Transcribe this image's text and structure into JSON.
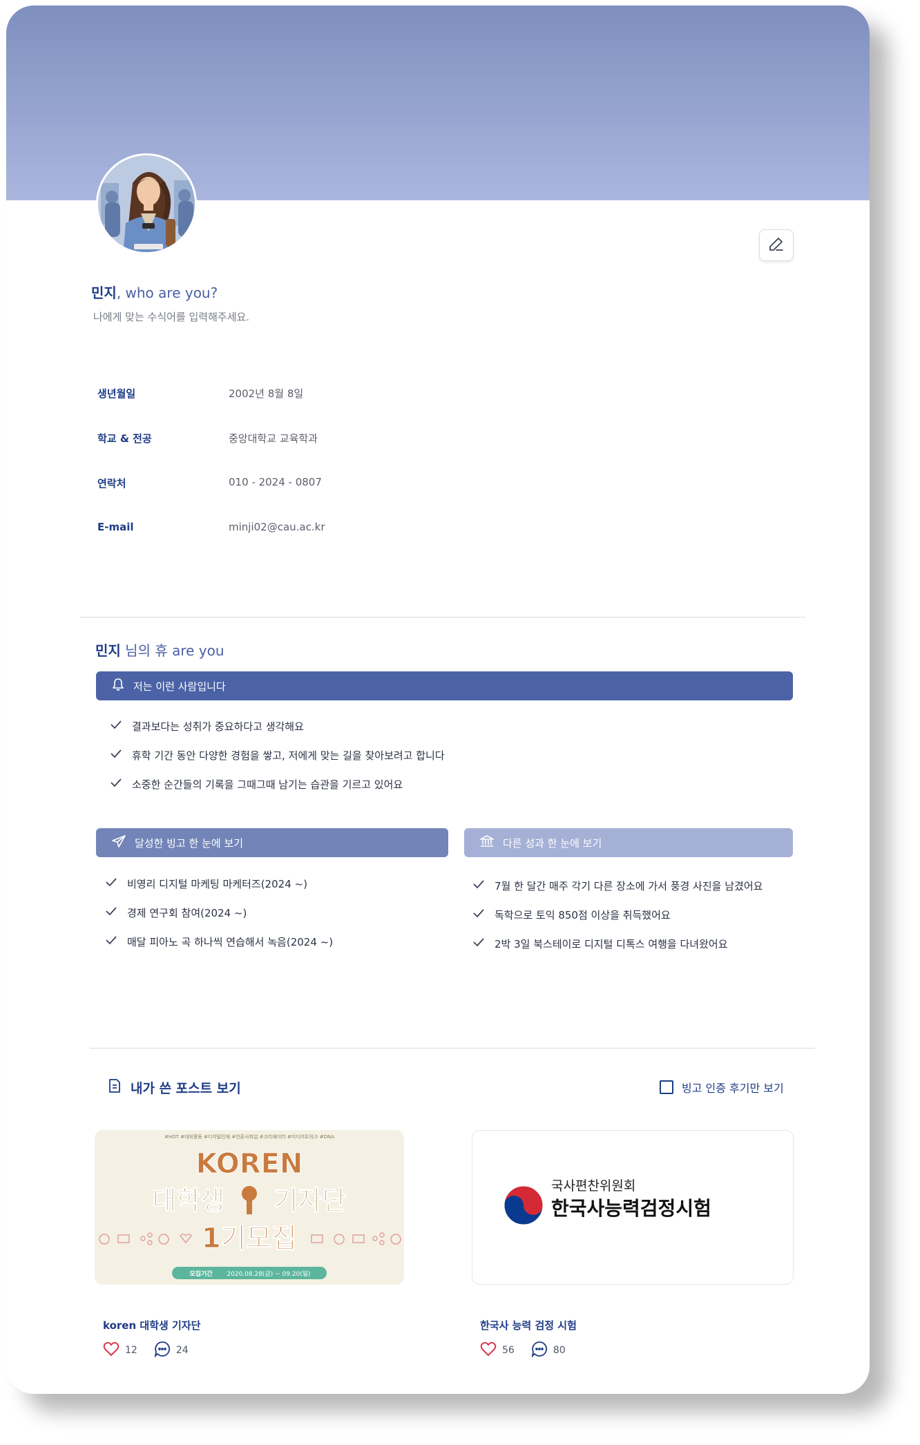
{
  "profile": {
    "name": "민지",
    "greeting_suffix": ", who are you?",
    "subtitle": "나에게 맞는 수식어를 입력해주세요."
  },
  "info": [
    {
      "label": "생년월일",
      "value": "2002년 8월 8일"
    },
    {
      "label": "학교 & 전공",
      "value": "중앙대학교 교육학과"
    },
    {
      "label": "연락처",
      "value": "010 - 2024 - 0807"
    },
    {
      "label": "E-mail",
      "value": "minji02@cau.ac.kr"
    }
  ],
  "who": {
    "name": "민지",
    "suffix": " 님의 휴 are you",
    "intro_bar": "저는 이런 사람입니다",
    "intro_items": [
      "결과보다는 성취가 중요하다고 생각해요",
      "휴학 기간 동안 다양한 경험을 쌓고, 저에게 맞는 길을 찾아보려고 합니다",
      "소중한 순간들의 기록을 그때그때 남기는 습관을 기르고 있어요"
    ],
    "bingo_bar": "달성한 빙고 한 눈에 보기",
    "bingo_items": [
      "비영리 디지털 마케팅 마케터즈(2024 ~)",
      "경제 연구회 참여(2024 ~)",
      "매달 피아노 곡 하나씩 연습해서 녹음(2024 ~)"
    ],
    "other_bar": "다른 성과 한 눈에 보기",
    "other_items": [
      "7월 한 달간 매주 각기 다른 장소에 가서 풍경 사진을 남겼어요",
      "독학으로 토익 850점 이상을 취득했어요",
      "2박 3일 북스테이로 디지털 디톡스 여행을 다녀왔어요"
    ]
  },
  "posts": {
    "heading": "내가 쓴 포스트 보기",
    "filter_label": "빙고 인증 후기만 보기",
    "items": [
      {
        "title": "koren 대학생 기자단",
        "likes": "12",
        "comments": "24",
        "thumb": {
          "tags": "#HOT #대외활동 #디지털인재 #언론사취업 #크리에이터 #미디어트워크 #DNA",
          "line1": "KOREN",
          "line2a": "대학생",
          "line2b": "기자단",
          "line3": "1기모집",
          "period_label": "모집기간",
          "period": "2020.08.28(금) ~ 09.20(일)"
        }
      },
      {
        "title": "한국사 능력 검정 시험",
        "likes": "56",
        "comments": "80",
        "thumb": {
          "org": "국사편찬위원회",
          "name": "한국사능력검정시험"
        }
      }
    ]
  },
  "colors": {
    "navy": "#1f3c86",
    "bar_primary": "#4b63a6",
    "bar_secondary": "#7385b8",
    "bar_tertiary": "#a5b0d6",
    "heart": "#d6374a"
  }
}
